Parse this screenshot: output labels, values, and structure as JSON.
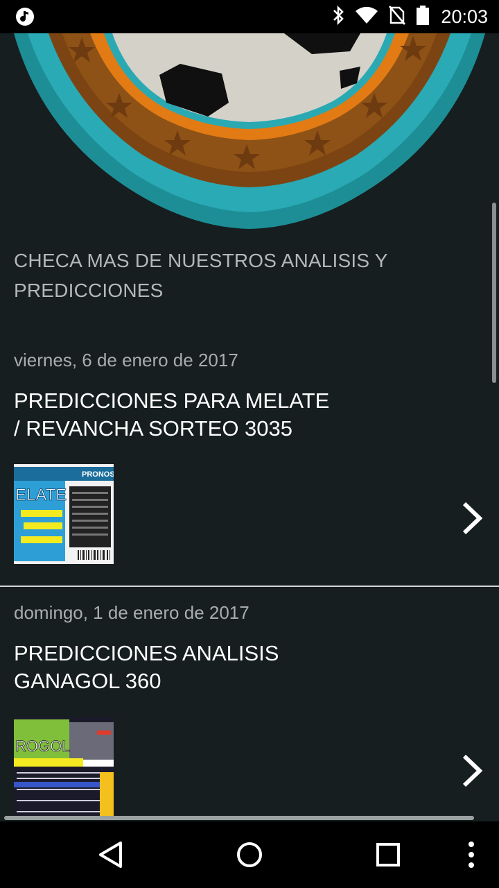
{
  "status_bar": {
    "time": "20:03",
    "icons": [
      "music-note-icon",
      "bluetooth-icon",
      "wifi-icon",
      "no-sim-icon",
      "battery-icon"
    ]
  },
  "section": {
    "heading": "CHECA MAS DE NUESTROS ANALISIS Y PREDICCIONES"
  },
  "posts": [
    {
      "date": "viernes, 6 de enero de 2017",
      "title_line1": "PREDICCIONES PARA MELATE",
      "title_line2": "/ REVANCHA SORTEO 3035",
      "thumb_text_a": "PRONOS",
      "thumb_text_b": "ELATE"
    },
    {
      "date": "domingo, 1 de enero de 2017",
      "title_line1": "PREDICCIONES ANALISIS",
      "title_line2": "GANAGOL 360",
      "thumb_text_a": "ROGOL",
      "thumb_text_b": ""
    }
  ],
  "colors": {
    "background": "#161e1f",
    "badge_teal": "#27a3ad",
    "badge_orange": "#e07b16",
    "badge_brown": "#8a4a12"
  }
}
